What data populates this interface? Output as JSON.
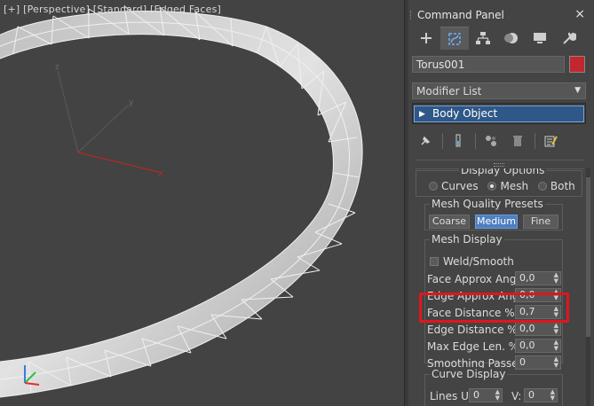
{
  "viewport": {
    "label_parts": [
      "[+]",
      "[Perspective]",
      "[Standard]",
      "[Edged Faces]"
    ],
    "axis": {
      "x": "x",
      "y": "y",
      "z": "z"
    },
    "colors": {
      "bg": "#434343",
      "wire": "#f0f0f0",
      "x_axis": "#d02020",
      "y_axis": "#5a5a5a"
    }
  },
  "panel": {
    "title": "Command Panel",
    "close": "×",
    "tabs": [
      {
        "name": "create",
        "icon": "plus-icon"
      },
      {
        "name": "modify",
        "icon": "modify-icon",
        "active": true
      },
      {
        "name": "hierarchy",
        "icon": "hierarchy-icon"
      },
      {
        "name": "motion",
        "icon": "motion-icon"
      },
      {
        "name": "display",
        "icon": "display-icon"
      },
      {
        "name": "utilities",
        "icon": "wrench-icon"
      }
    ],
    "object_name": "Torus001",
    "object_color": "#c1272d",
    "modifier_list": "Modifier List",
    "modifier_arrow": "▼",
    "stack_item": "Body Object",
    "stack_item_arrow": "▶"
  },
  "display_options": {
    "title": "Display Options",
    "modes": [
      {
        "label": "Curves",
        "selected": false
      },
      {
        "label": "Mesh",
        "selected": true
      },
      {
        "label": "Both",
        "selected": false
      }
    ]
  },
  "mesh_quality": {
    "title": "Mesh Quality Presets",
    "presets": [
      {
        "label": "Coarse",
        "selected": false
      },
      {
        "label": "Medium",
        "selected": true
      },
      {
        "label": "Fine",
        "selected": false
      }
    ]
  },
  "mesh_display": {
    "title": "Mesh Display",
    "weld_smooth": "Weld/Smooth",
    "fields": [
      {
        "label": "Face Approx Angle:",
        "value": "0,0"
      },
      {
        "label": "Edge Approx Angle:",
        "value": "0,0"
      },
      {
        "label": "Face Distance %:",
        "value": "0,7"
      },
      {
        "label": "Edge Distance %:",
        "value": "0,0"
      },
      {
        "label": "Max Edge Len. %:",
        "value": "0,0"
      },
      {
        "label": "Smoothing Passes:",
        "value": "0"
      }
    ]
  },
  "curve_display": {
    "title": "Curve Display",
    "lines_u_label": "Lines U:",
    "lines_u_value": "0",
    "v_label": "V:",
    "v_value": "0"
  },
  "spinner_arrows": "▲▼",
  "highlight_color": "#e2151c"
}
